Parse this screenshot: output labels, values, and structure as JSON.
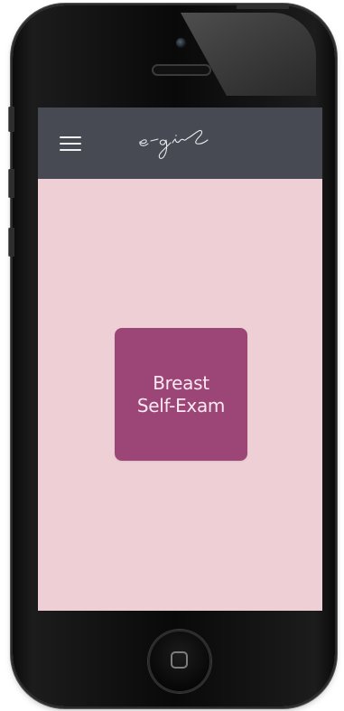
{
  "device": {
    "type": "smartphone",
    "body_color": "#0b0b0b"
  },
  "app": {
    "brand": "e-girl",
    "app_bar_color": "#474a52",
    "background_color": "#efcfd6",
    "menu_icon": "hamburger-menu-icon"
  },
  "tile": {
    "line1": "Breast",
    "line2": "Self-Exam",
    "color": "#9c4677",
    "text_color": "#fbe9f1"
  }
}
